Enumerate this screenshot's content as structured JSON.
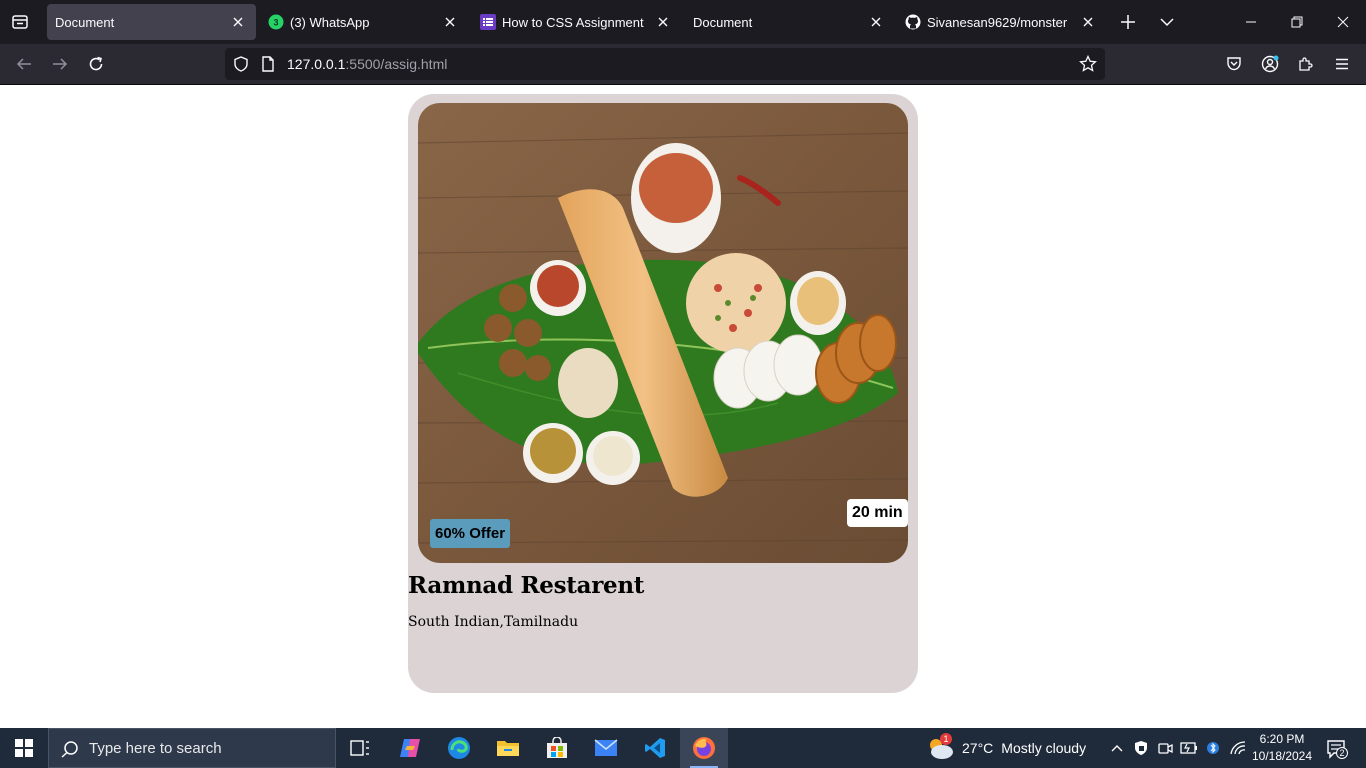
{
  "browser": {
    "tabs": [
      {
        "title": "Document",
        "active": true,
        "icon": "document-icon"
      },
      {
        "title": "(3) WhatsApp",
        "active": false,
        "icon": "whatsapp-icon",
        "badge": "3"
      },
      {
        "title": "How to CSS Assignment",
        "active": false,
        "icon": "list-app-icon"
      },
      {
        "title": "Document",
        "active": false,
        "icon": "document-icon"
      },
      {
        "title": "Sivanesan9629/monster",
        "active": false,
        "icon": "github-icon"
      }
    ],
    "url_host": "127.0.0.1",
    "url_rest": ":5500/assig.html"
  },
  "card": {
    "offer": "60% Offer",
    "delivery_time": "20 min",
    "restaurant_name": "Ramnad Restarent",
    "cuisine": "South Indian,Tamilnadu",
    "background_color": "#dcd4d4",
    "offer_color": "#5b9bbc",
    "image_alt": "south-indian-food-platter"
  },
  "taskbar": {
    "search_placeholder": "Type here to search",
    "weather": {
      "temperature": "27°C",
      "condition": "Mostly cloudy",
      "alert_badge": "1"
    },
    "clock": {
      "time": "6:20 PM",
      "date": "10/18/2024"
    },
    "notification_count": "2"
  },
  "colors": {
    "tabstrip": "#1c1b22",
    "navbar": "#2b2a33",
    "taskbar": "#1f2a3a"
  }
}
